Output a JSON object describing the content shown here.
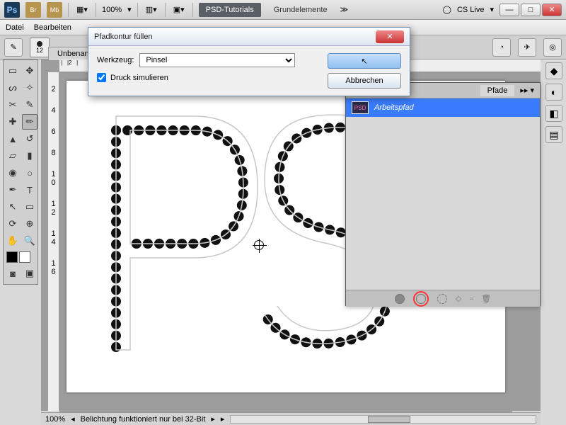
{
  "topbar": {
    "zoom": "100%",
    "workspace_btn": "PSD-Tutorials",
    "workspace_alt": "Grundelemente",
    "cslive": "CS Live"
  },
  "menubar": {
    "file": "Datei",
    "edit": "Bearbeiten"
  },
  "optbar": {
    "brush_size": "12"
  },
  "document": {
    "tab_name": "Unbenann..."
  },
  "dialog": {
    "title": "Pfadkontur füllen",
    "tool_label": "Werkzeug:",
    "tool_value": "Pinsel",
    "simulate_pressure": "Druck simulieren",
    "ok": " ",
    "cancel": "Abbrechen"
  },
  "paths_panel": {
    "tab": "Pfade",
    "item": "Arbeitspfad"
  },
  "statusbar": {
    "zoom": "100%",
    "info": "Belichtung funktioniert nur bei 32-Bit"
  },
  "ruler_v": [
    "2",
    "4",
    "6",
    "8",
    "1\n0",
    "1\n2",
    "1\n4",
    "1\n6"
  ]
}
